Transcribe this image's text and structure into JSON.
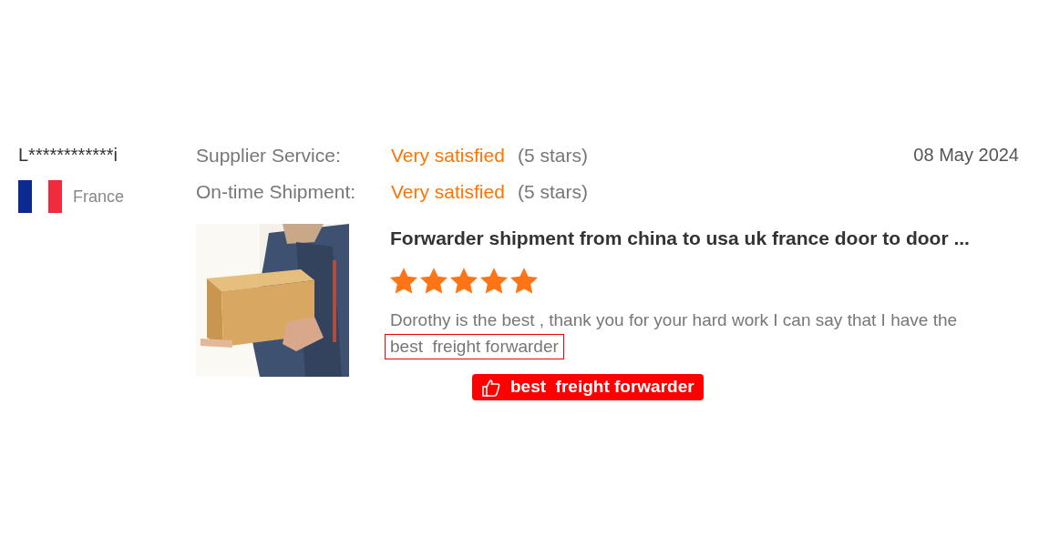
{
  "reviewer": {
    "name": "L************i",
    "country": "France"
  },
  "ratings": [
    {
      "label": "Supplier Service:",
      "value": "Very satisfied",
      "detail": "(5 stars)"
    },
    {
      "label": "On-time Shipment:",
      "value": "Very satisfied",
      "detail": "(5 stars)"
    }
  ],
  "date": "08 May 2024",
  "product": {
    "title": "Forwarder shipment from china to usa uk france door to door ...",
    "stars": 5
  },
  "review": {
    "text": "Dorothy is the best , thank you for your hard work I can say that I have the",
    "highlight": "best  freight forwarder"
  },
  "tag": "best  freight forwarder"
}
